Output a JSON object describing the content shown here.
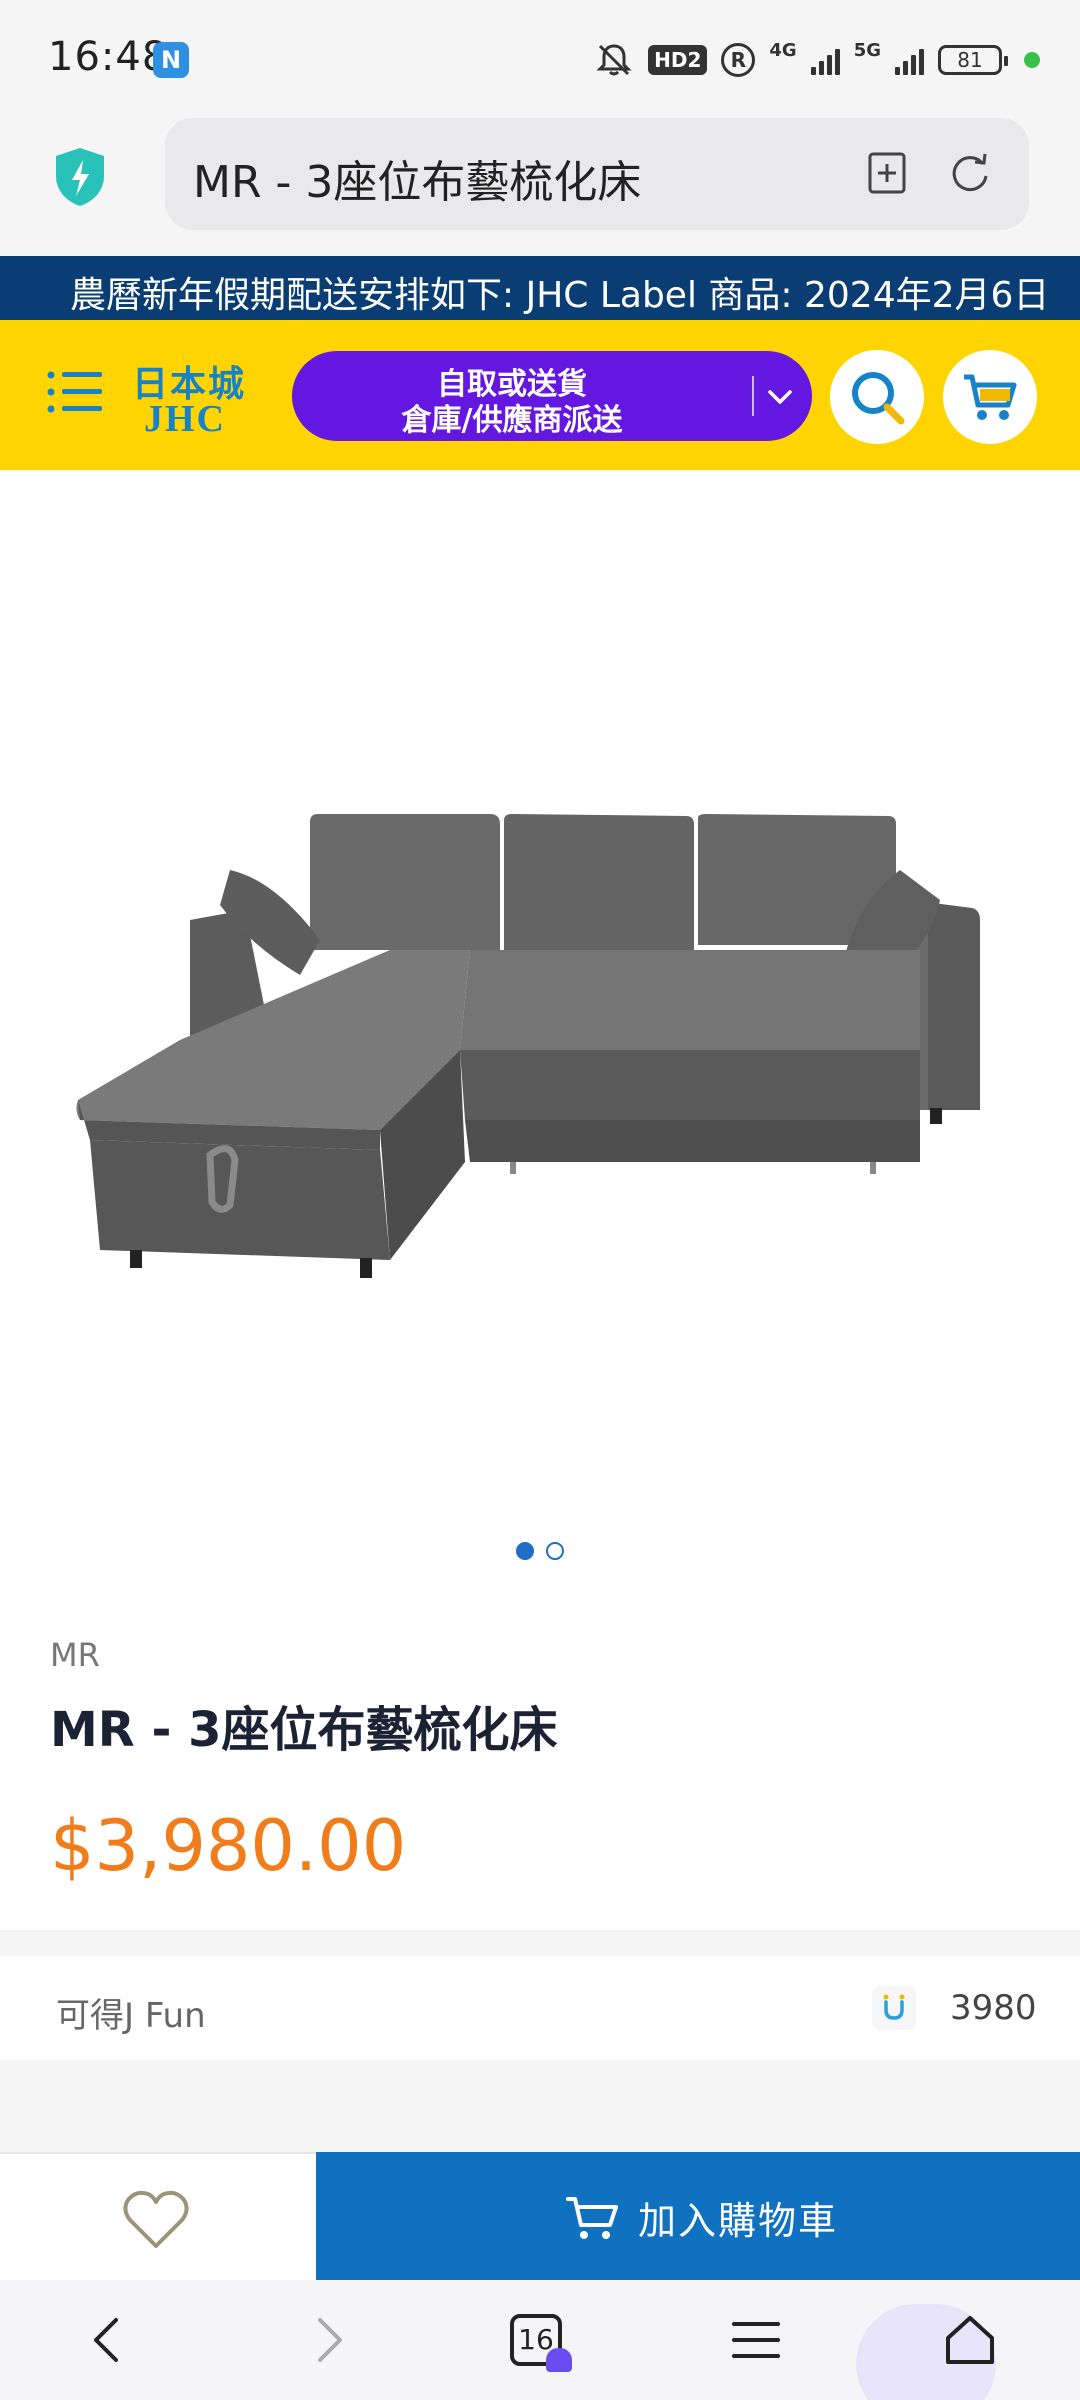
{
  "status_bar": {
    "time": "16:48",
    "nfc_badge": "N",
    "hd_badge": "HD2",
    "r_badge": "R",
    "network1": "4G",
    "network2": "5G",
    "battery": "81"
  },
  "browser": {
    "url_title": "MR - 3座位布藝梳化床",
    "tab_count": "16",
    "icons": [
      "shield-bolt-icon",
      "bookmark-add-icon",
      "refresh-icon",
      "back-icon",
      "forward-icon",
      "tabs-icon",
      "menu-icon",
      "home-icon"
    ]
  },
  "announcement": {
    "text": "農曆新年假期配送安排如下: JHC Label 商品: 2024年2月6日"
  },
  "site_header": {
    "logo_jp": "日本城",
    "logo_en": "JHC",
    "delivery_line1": "自取或送貨",
    "delivery_line2": "倉庫/供應商派送",
    "colors": {
      "header_bg": "#ffd400",
      "delivery_bg": "#6417e0",
      "accent": "#1683c9"
    }
  },
  "gallery": {
    "image": "grey-l-shaped-sofa-bed-image",
    "slide_count": 2,
    "active_slide": 1
  },
  "product": {
    "brand": "MR",
    "title": "MR - 3座位布藝梳化床",
    "price": "$3,980.00",
    "price_color": "#f07d1a"
  },
  "jfun": {
    "label": "可得J Fun",
    "value": "3980"
  },
  "actions": {
    "add_to_cart": "加入購物車",
    "button_color": "#1171c1"
  }
}
